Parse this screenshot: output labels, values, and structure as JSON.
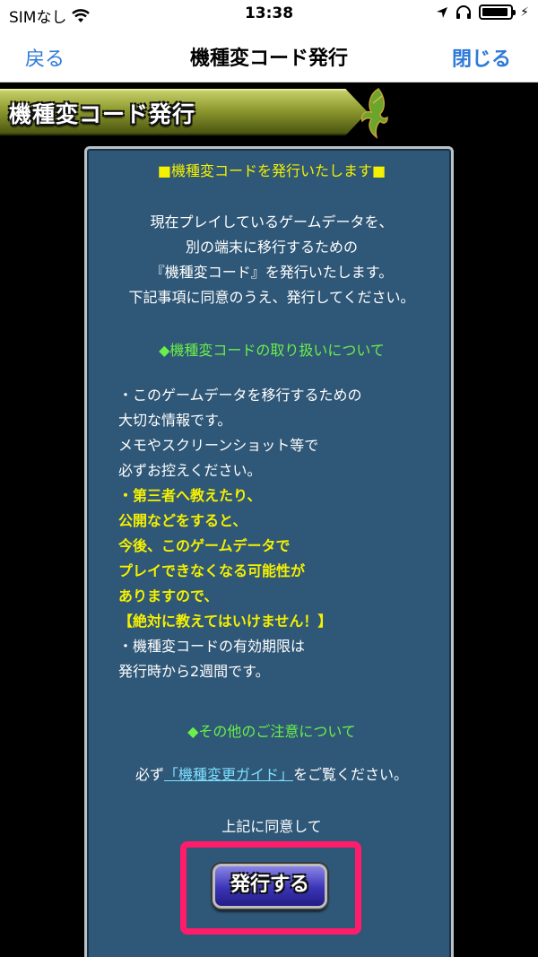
{
  "status_bar": {
    "carrier": "SIMなし",
    "time": "13:38"
  },
  "nav": {
    "back_label": "戻る",
    "title": "機種変コード発行",
    "close_label": "閉じる"
  },
  "banner": {
    "title": "機種変コード発行"
  },
  "panel": {
    "heading": "■機種変コードを発行いたします■",
    "intro": [
      "現在プレイしているゲームデータを、",
      "別の端末に移行するための",
      "『機種変コード』を発行いたします。",
      "下記事項に同意のうえ、発行してください。"
    ],
    "section1_title": "◆機種変コードの取り扱いについて",
    "notes": [
      "・このゲームデータを移行するための",
      "大切な情報です。",
      "メモやスクリーンショット等で",
      "必ずお控えください。"
    ],
    "warnings": [
      "・第三者へ教えたり、",
      "公開などをすると、",
      "今後、このゲームデータで",
      "プレイできなくなる可能性が",
      "ありますので、",
      "【絶対に教えてはいけません！】"
    ],
    "expiry": [
      "・機種変コードの有効期限は",
      "発行時から2週間です。"
    ],
    "section2_title": "◆その他のご注意について",
    "guide_prefix": "必ず",
    "guide_link": "「機種変更ガイド」",
    "guide_suffix": "をご覧ください。",
    "agree_text": "上記に同意して",
    "issue_button": "発行する"
  },
  "colors": {
    "panel_bg": "#2f5777",
    "highlight": "#ff1c6b",
    "link": "#2f7ad9"
  }
}
